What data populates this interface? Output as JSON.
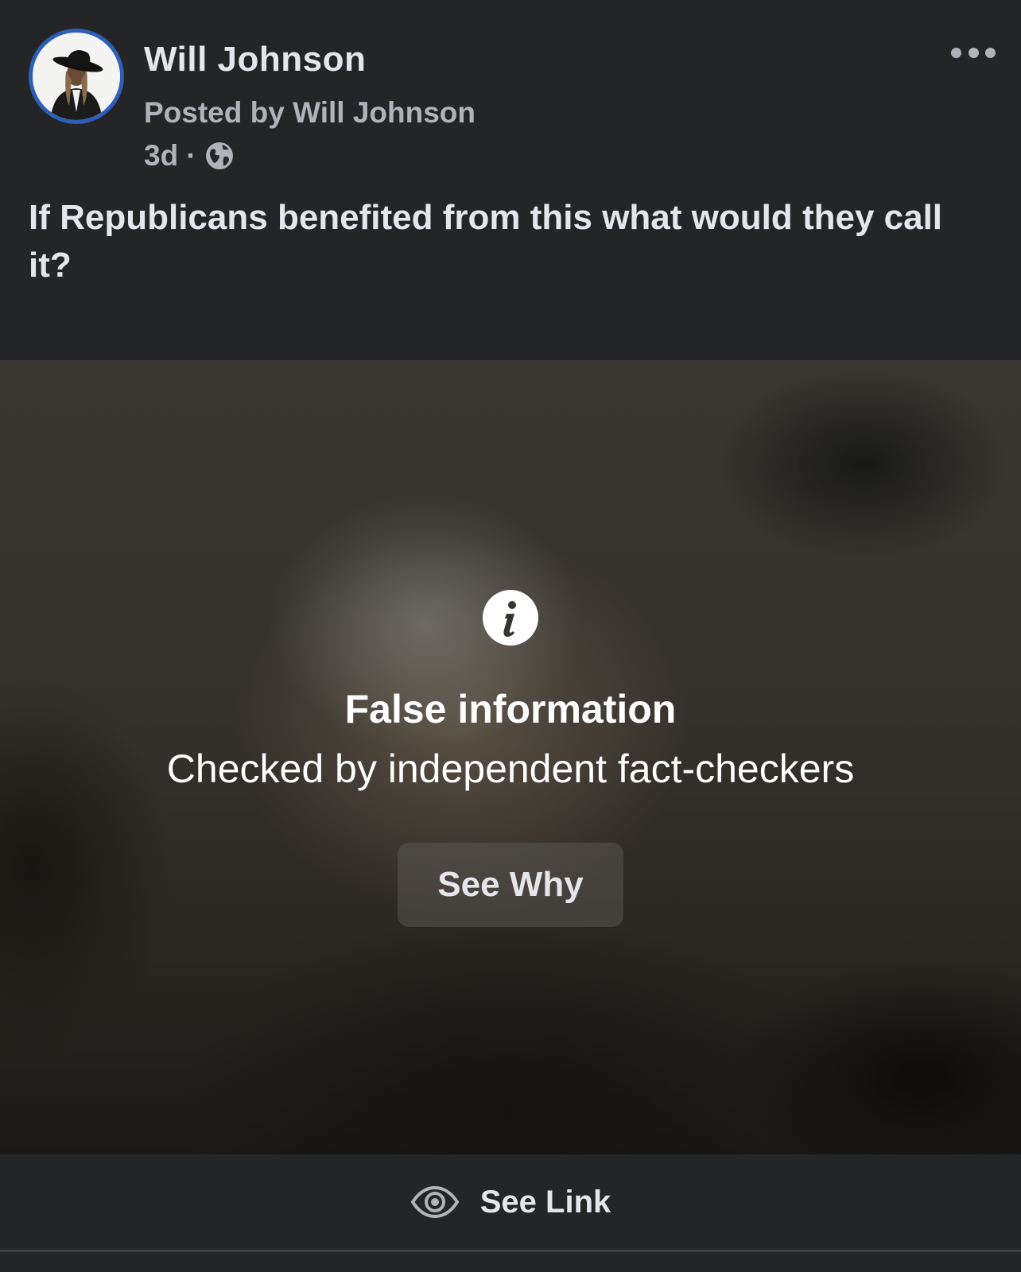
{
  "post": {
    "author": "Will Johnson",
    "posted_by": "Posted by Will Johnson",
    "time": "3d",
    "separator": "·",
    "privacy_icon": "globe-icon",
    "more_icon": "more-horizontal-icon",
    "text": "If Republicans benefited from this what would they call it?"
  },
  "fact_check": {
    "icon": "info-icon",
    "title": "False information",
    "subtitle": "Checked by independent fact-checkers",
    "button_label": "See Why"
  },
  "footer": {
    "see_link_icon": "eye-icon",
    "see_link_label": "See Link"
  },
  "colors": {
    "background": "#242527",
    "avatar_ring": "#2d5fb8",
    "primary_text": "#e4e6eb",
    "secondary_text": "#b0b3b8"
  }
}
